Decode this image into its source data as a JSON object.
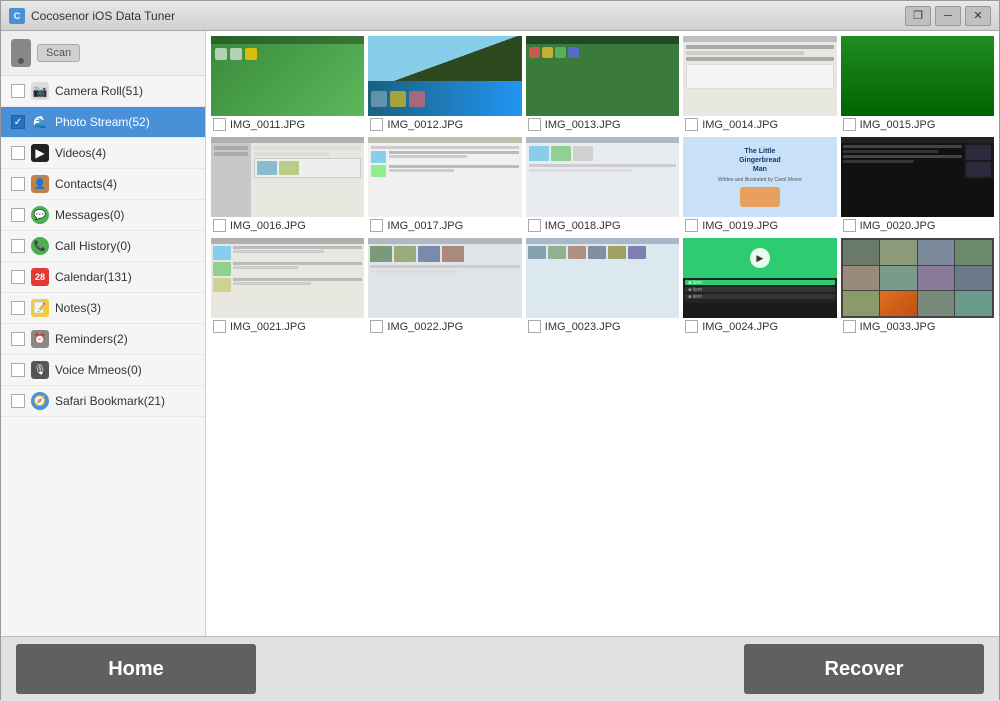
{
  "titlebar": {
    "title": "Cocosenor iOS Data Tuner",
    "icon": "C",
    "controls": {
      "restore": "❐",
      "minimize": "─",
      "close": "✕"
    }
  },
  "sidebar": {
    "scan_button": "Scan",
    "items": [
      {
        "id": "camera-roll",
        "label": "Camera Roll(51)",
        "icon": "📷",
        "active": false,
        "checked": false,
        "color": "#888"
      },
      {
        "id": "photo-stream",
        "label": "Photo Stream(52)",
        "icon": "🌊",
        "active": true,
        "checked": true,
        "color": "#f0a000"
      },
      {
        "id": "videos",
        "label": "Videos(4)",
        "icon": "🎬",
        "active": false,
        "checked": false,
        "color": "#333"
      },
      {
        "id": "contacts",
        "label": "Contacts(4)",
        "icon": "👤",
        "active": false,
        "checked": false,
        "color": "#c0824a"
      },
      {
        "id": "messages",
        "label": "Messages(0)",
        "icon": "💬",
        "active": false,
        "checked": false,
        "color": "#4caf50"
      },
      {
        "id": "call-history",
        "label": "Call History(0)",
        "icon": "📞",
        "active": false,
        "checked": false,
        "color": "#4caf50"
      },
      {
        "id": "calendar",
        "label": "Calendar(131)",
        "icon": "📅",
        "active": false,
        "checked": false,
        "color": "#e53935"
      },
      {
        "id": "notes",
        "label": "Notes(3)",
        "icon": "📝",
        "active": false,
        "checked": false,
        "color": "#f5a623"
      },
      {
        "id": "reminders",
        "label": "Reminders(2)",
        "icon": "⏰",
        "active": false,
        "checked": false,
        "color": "#888"
      },
      {
        "id": "voice-memos",
        "label": "Voice Mmeos(0)",
        "icon": "🎙",
        "active": false,
        "checked": false,
        "color": "#666"
      },
      {
        "id": "safari-bookmark",
        "label": "Safari Bookmark(21)",
        "icon": "🧭",
        "active": false,
        "checked": false,
        "color": "#4a90d9"
      }
    ]
  },
  "images": [
    {
      "name": "IMG_0011.JPG",
      "thumbType": "green-desktop"
    },
    {
      "name": "IMG_0012.JPG",
      "thumbType": "teal-desktop"
    },
    {
      "name": "IMG_0013.JPG",
      "thumbType": "orange-desktop"
    },
    {
      "name": "IMG_0014.JPG",
      "thumbType": "dark-desktop"
    },
    {
      "name": "IMG_0015.JPG",
      "thumbType": "nature"
    },
    {
      "name": "IMG_0016.JPG",
      "thumbType": "green-desktop2"
    },
    {
      "name": "IMG_0017.JPG",
      "thumbType": "filemanager"
    },
    {
      "name": "IMG_0018.JPG",
      "thumbType": "filemanager2"
    },
    {
      "name": "IMG_0019.JPG",
      "thumbType": "filemanager3"
    },
    {
      "name": "IMG_0020.JPG",
      "thumbType": "dark-app"
    },
    {
      "name": "IMG_0021.JPG",
      "thumbType": "filemanager4"
    },
    {
      "name": "IMG_0022.JPG",
      "thumbType": "filemanager5"
    },
    {
      "name": "IMG_0023.JPG",
      "thumbType": "filemanager6"
    },
    {
      "name": "IMG_0024.JPG",
      "thumbType": "video-player"
    },
    {
      "name": "IMG_0033.JPG",
      "thumbType": "photo-grid"
    }
  ],
  "buttons": {
    "home": "Home",
    "recover": "Recover"
  }
}
